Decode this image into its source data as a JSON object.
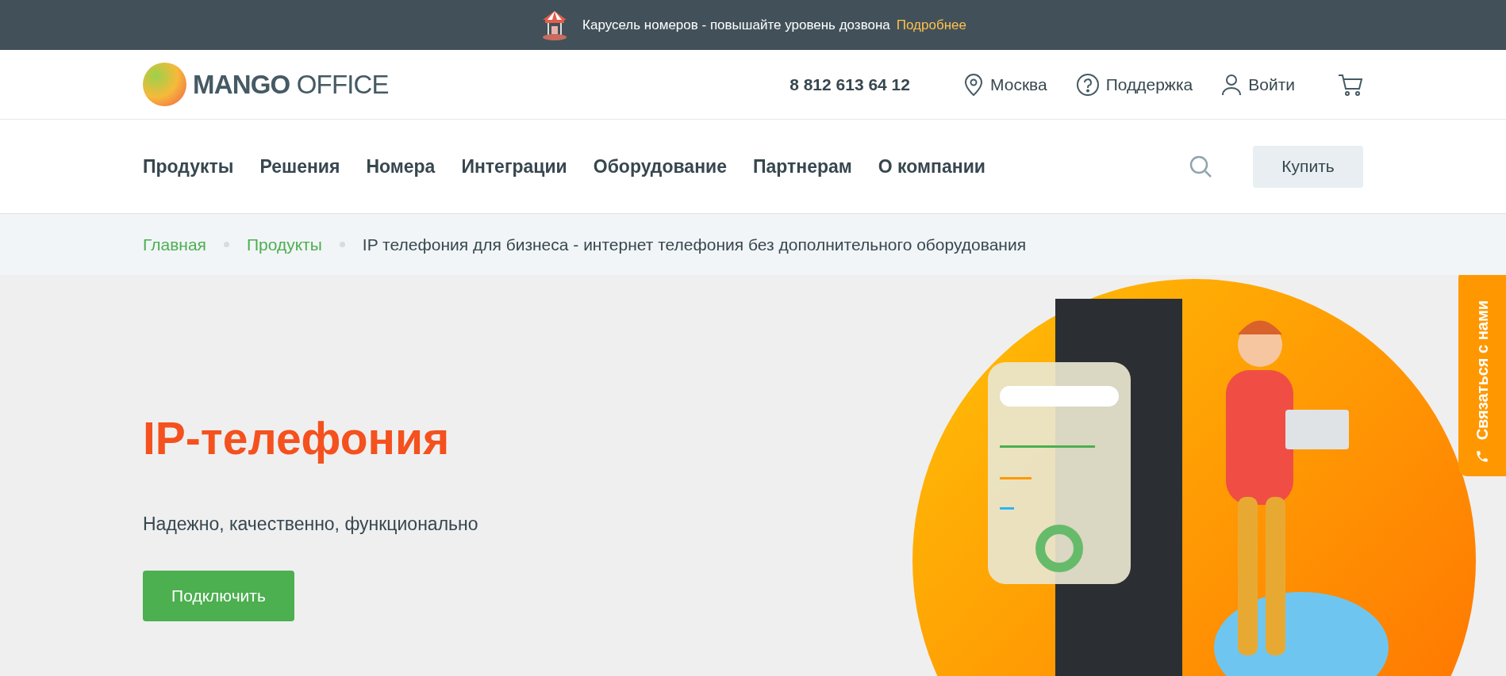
{
  "promo_bar": {
    "text": "Карусель номеров - повышайте уровень дозвона",
    "link": "Подробнее"
  },
  "header": {
    "logo": {
      "bold": "MANGO",
      "light": "OFFICE"
    },
    "phone": "8 812 613 64 12",
    "links": [
      {
        "kind": "location",
        "label": "Москва"
      },
      {
        "kind": "support",
        "label": "Поддержка"
      },
      {
        "kind": "login",
        "label": "Войти"
      },
      {
        "kind": "cart"
      }
    ]
  },
  "nav": {
    "items": [
      "Продукты",
      "Решения",
      "Номера",
      "Интеграции",
      "Оборудование",
      "Партнерам",
      "О компании"
    ],
    "buy_button": "Купить"
  },
  "breadcrumbs": [
    {
      "label": "Главная",
      "link": true
    },
    {
      "label": "Продукты",
      "link": true
    },
    {
      "label": "IP телефония для бизнеса - интернет телефония без дополнительного оборудования",
      "link": false
    }
  ],
  "hero": {
    "title": "IP-телефония",
    "subtitle": "Надежно, качественно, функционально",
    "button": "Подключить"
  },
  "side_tab": {
    "label": "Связаться с нами"
  }
}
